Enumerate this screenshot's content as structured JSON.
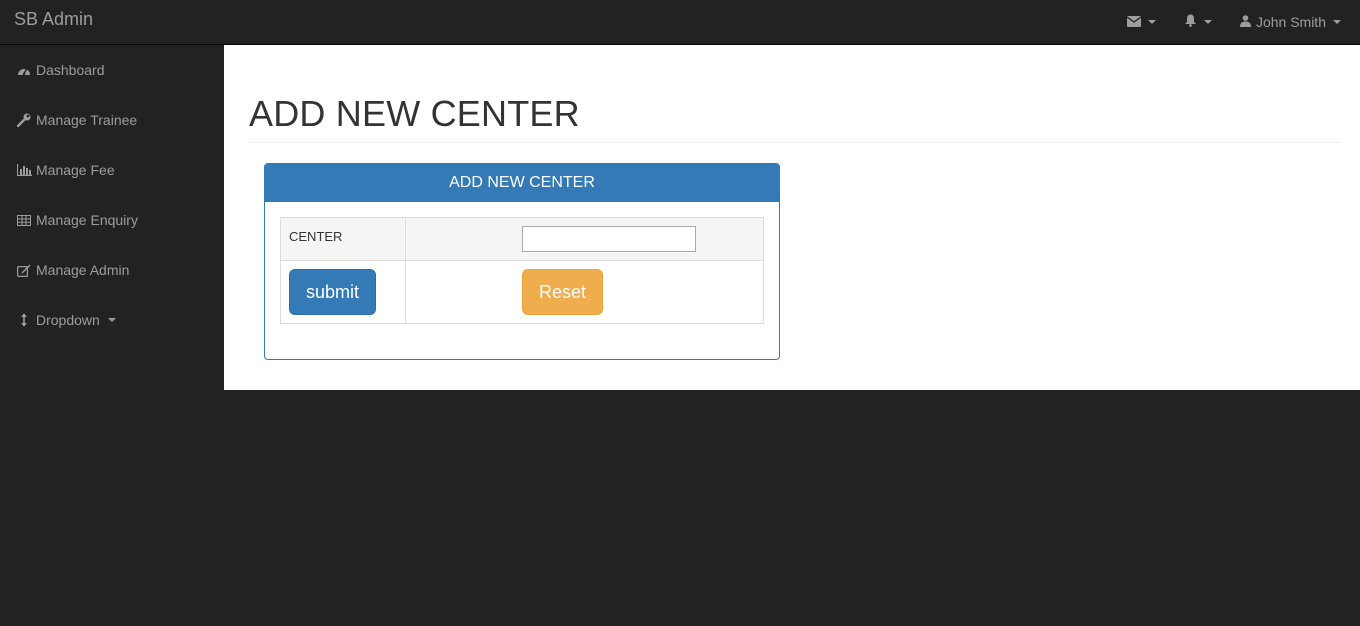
{
  "navbar": {
    "brand": "SB Admin",
    "user_name": "John Smith",
    "icons": [
      "envelope-icon",
      "bell-icon",
      "user-icon"
    ]
  },
  "sidebar": {
    "items": [
      {
        "label": "Dashboard",
        "icon": "dashboard-icon"
      },
      {
        "label": "Manage Trainee",
        "icon": "wrench-icon"
      },
      {
        "label": "Manage Fee",
        "icon": "bar-chart-icon"
      },
      {
        "label": "Manage Enquiry",
        "icon": "table-icon"
      },
      {
        "label": "Manage Admin",
        "icon": "edit-icon"
      },
      {
        "label": "Dropdown",
        "icon": "arrows-vertical-icon"
      }
    ]
  },
  "main": {
    "page_title": "ADD NEW CENTER",
    "panel": {
      "heading": "ADD NEW CENTER",
      "field_label": "CENTER",
      "field_value": "",
      "submit_label": "submit",
      "reset_label": "Reset"
    }
  },
  "colors": {
    "primary": "#337ab7",
    "warning": "#f0ad4e",
    "navbar_bg": "#222222",
    "nav_text": "#9d9d9d"
  }
}
